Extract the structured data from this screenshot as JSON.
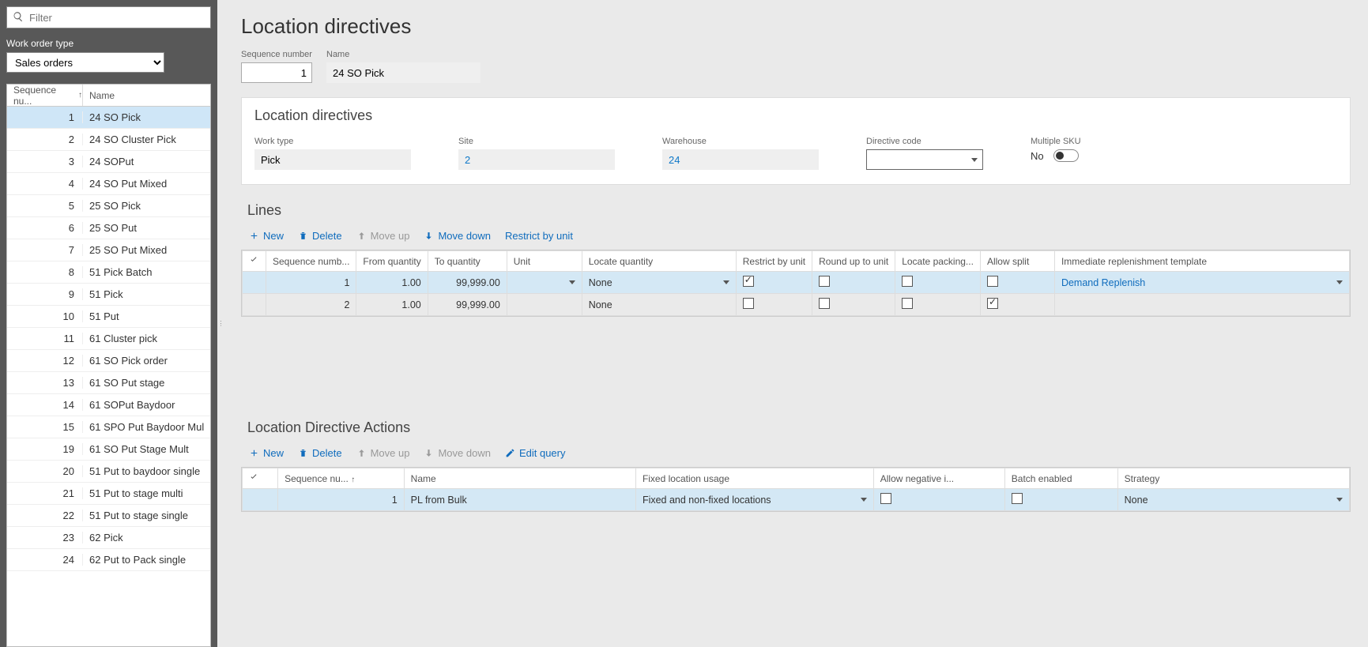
{
  "filter": {
    "placeholder": "Filter"
  },
  "work_order_type": {
    "label": "Work order type",
    "value": "Sales orders"
  },
  "dir_list": {
    "headers": {
      "seq": "Sequence nu...",
      "name": "Name"
    },
    "items": [
      {
        "seq": "1",
        "name": "24 SO Pick",
        "selected": true
      },
      {
        "seq": "2",
        "name": "24 SO Cluster Pick"
      },
      {
        "seq": "3",
        "name": "24 SOPut"
      },
      {
        "seq": "4",
        "name": "24 SO Put Mixed"
      },
      {
        "seq": "5",
        "name": "25 SO Pick"
      },
      {
        "seq": "6",
        "name": "25 SO Put"
      },
      {
        "seq": "7",
        "name": "25 SO Put Mixed"
      },
      {
        "seq": "8",
        "name": "51 Pick Batch"
      },
      {
        "seq": "9",
        "name": "51 Pick"
      },
      {
        "seq": "10",
        "name": "51 Put"
      },
      {
        "seq": "11",
        "name": "61 Cluster pick"
      },
      {
        "seq": "12",
        "name": "61 SO Pick order"
      },
      {
        "seq": "13",
        "name": "61 SO Put stage"
      },
      {
        "seq": "14",
        "name": "61 SOPut Baydoor"
      },
      {
        "seq": "15",
        "name": "61 SPO Put Baydoor Mul"
      },
      {
        "seq": "19",
        "name": "61 SO Put Stage Mult"
      },
      {
        "seq": "20",
        "name": "51 Put to baydoor single"
      },
      {
        "seq": "21",
        "name": "51 Put to stage multi"
      },
      {
        "seq": "22",
        "name": "51 Put to stage single"
      },
      {
        "seq": "23",
        "name": "62 Pick"
      },
      {
        "seq": "24",
        "name": "62 Put to Pack single"
      }
    ]
  },
  "page": {
    "title": "Location directives"
  },
  "header": {
    "seq_label": "Sequence number",
    "seq_value": "1",
    "name_label": "Name",
    "name_value": "24 SO Pick"
  },
  "card1": {
    "title": "Location directives",
    "work_type": {
      "label": "Work type",
      "value": "Pick"
    },
    "site": {
      "label": "Site",
      "value": "2"
    },
    "warehouse": {
      "label": "Warehouse",
      "value": "24"
    },
    "directive_code": {
      "label": "Directive code",
      "value": ""
    },
    "multiple_sku": {
      "label": "Multiple SKU",
      "value": "No"
    }
  },
  "lines": {
    "title": "Lines",
    "toolbar": {
      "new": "New",
      "delete": "Delete",
      "moveup": "Move up",
      "movedown": "Move down",
      "restrict": "Restrict by unit"
    },
    "headers": {
      "seq": "Sequence numb...",
      "from": "From quantity",
      "to": "To quantity",
      "unit": "Unit",
      "locate_qty": "Locate quantity",
      "restrict": "Restrict by unit",
      "roundup": "Round up to unit",
      "locate_pack": "Locate packing...",
      "allow_split": "Allow split",
      "immediate": "Immediate replenishment template"
    },
    "rows": [
      {
        "seq": "1",
        "from": "1.00",
        "to": "99,999.00",
        "unit": "",
        "locate_qty": "None",
        "restrict": true,
        "roundup": false,
        "locate_pack": false,
        "allow_split": false,
        "immediate": "Demand Replenish",
        "selected": true
      },
      {
        "seq": "2",
        "from": "1.00",
        "to": "99,999.00",
        "unit": "",
        "locate_qty": "None",
        "restrict": false,
        "roundup": false,
        "locate_pack": false,
        "allow_split": true,
        "immediate": ""
      }
    ]
  },
  "actions": {
    "title": "Location Directive Actions",
    "toolbar": {
      "new": "New",
      "delete": "Delete",
      "moveup": "Move up",
      "movedown": "Move down",
      "edit_query": "Edit query"
    },
    "headers": {
      "seq": "Sequence nu...",
      "name": "Name",
      "fixed": "Fixed location usage",
      "neg": "Allow negative i...",
      "batch": "Batch enabled",
      "strategy": "Strategy"
    },
    "rows": [
      {
        "seq": "1",
        "name": "PL from Bulk",
        "fixed": "Fixed and non-fixed locations",
        "neg": false,
        "batch": false,
        "strategy": "None",
        "selected": true
      }
    ]
  }
}
